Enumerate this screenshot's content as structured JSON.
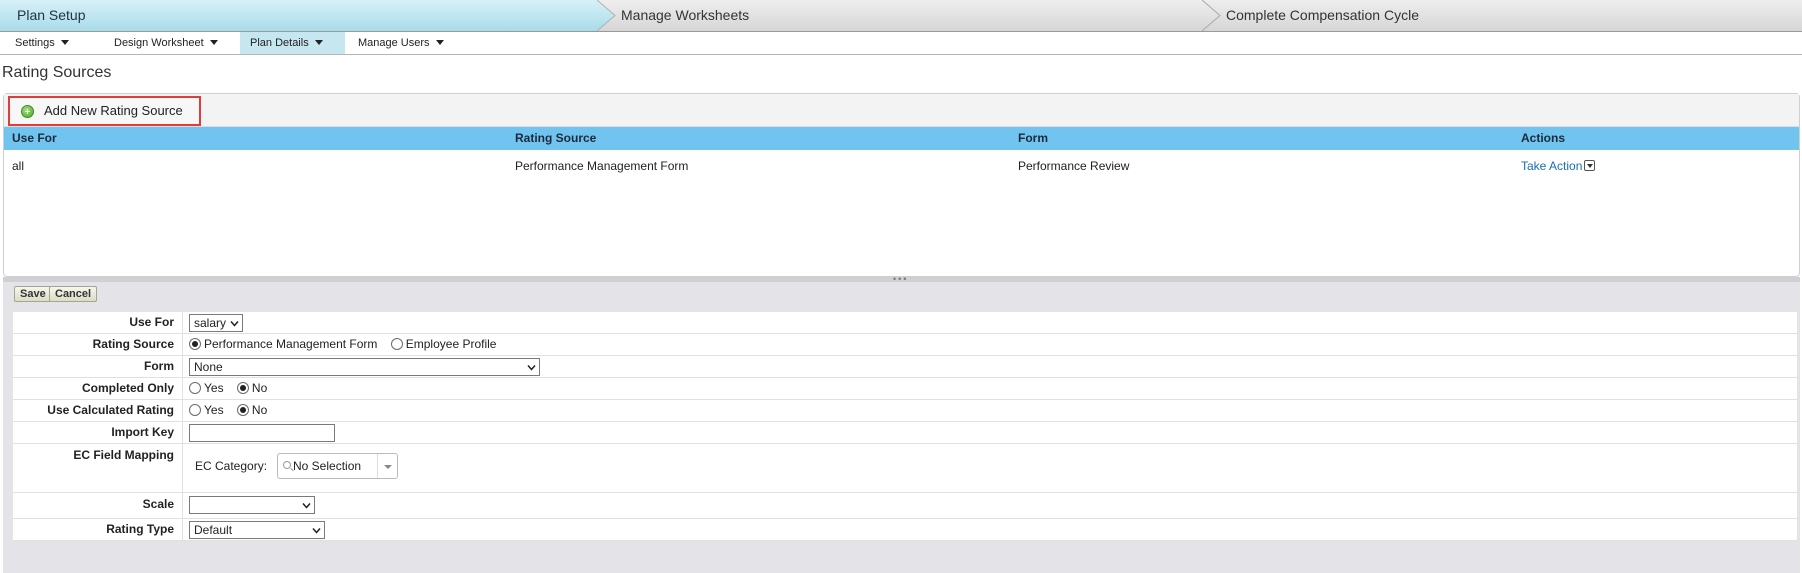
{
  "wizard": {
    "steps": [
      "Plan Setup",
      "Manage Worksheets",
      "Complete Compensation Cycle"
    ]
  },
  "menu": {
    "items": [
      "Settings",
      "Design Worksheet",
      "Plan Details",
      "Manage Users"
    ],
    "active": "Plan Details"
  },
  "page_title": "Rating Sources",
  "toolbar": {
    "add_label": "Add New Rating Source"
  },
  "table": {
    "columns": [
      "Use For",
      "Rating Source",
      "Form",
      "Actions"
    ],
    "rows": [
      {
        "use_for": "all",
        "rating_source": "Performance Management Form",
        "form": "Performance Review",
        "action": "Take Action"
      }
    ]
  },
  "form": {
    "save_label": "Save",
    "cancel_label": "Cancel",
    "use_for": {
      "label": "Use For",
      "value": "salary"
    },
    "rating_source": {
      "label": "Rating Source",
      "options": [
        "Performance Management Form",
        "Employee Profile"
      ],
      "selected": "Performance Management Form"
    },
    "form_field": {
      "label": "Form",
      "value": "None"
    },
    "completed_only": {
      "label": "Completed Only",
      "options": [
        "Yes",
        "No"
      ],
      "selected": "No"
    },
    "use_calculated": {
      "label": "Use Calculated Rating",
      "options": [
        "Yes",
        "No"
      ],
      "selected": "No"
    },
    "import_key": {
      "label": "Import Key",
      "value": ""
    },
    "ec_mapping": {
      "label": "EC Field Mapping",
      "category_label": "EC Category:",
      "category_value": "No Selection"
    },
    "scale": {
      "label": "Scale",
      "value": ""
    },
    "rating_type": {
      "label": "Rating Type",
      "value": "Default"
    }
  },
  "colors": {
    "header_blue": "#71c4f0",
    "step_active": "#a8dbe9",
    "highlight_border": "#e23b3b",
    "link": "#1a6fb0"
  }
}
